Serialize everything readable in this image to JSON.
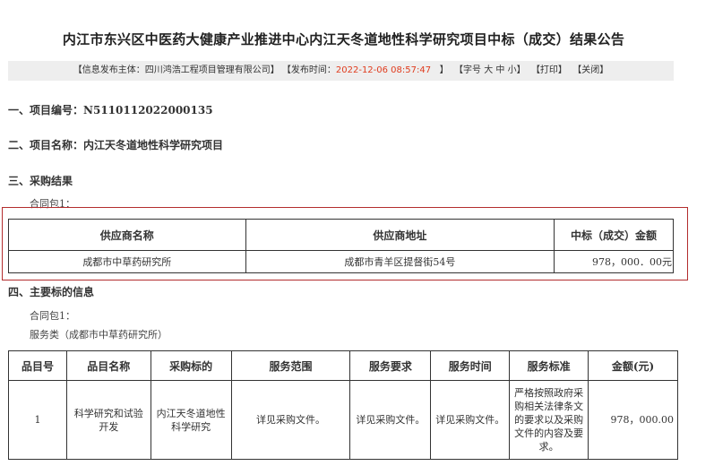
{
  "title": "内江市东兴区中医药大健康产业推进中心内江天冬道地性科学研究项目中标（成交）结果公告",
  "infobar": {
    "publisher_label": "【信息发布主体：四川鸿浩工程项目管理有限公司】",
    "time_label": "【发布时间：",
    "time_value": "2022-12-06 08:57:47",
    "time_close": "】",
    "font_size_label": "【字号",
    "font_big": "大",
    "font_mid": "中",
    "font_small": "小",
    "font_size_close": "】",
    "print": "【打印】",
    "close": "【关闭】"
  },
  "section1": {
    "label": "一、项目编号：",
    "value": "N5110112022000135"
  },
  "section2": {
    "label": "二、项目名称：内江天冬道地性科学研究项目"
  },
  "section3": {
    "label": "三、采购结果",
    "package": "合同包1："
  },
  "result_table": {
    "headers": [
      "供应商名称",
      "供应商地址",
      "中标（成交）金额"
    ],
    "row": [
      "成都市中草药研究所",
      "成都市青羊区提督街54号",
      "978，000．00元"
    ]
  },
  "section4": {
    "label": "四、主要标的信息",
    "package": "合同包1：",
    "category": "服务类（成都市中草药研究所）"
  },
  "item_table": {
    "headers": [
      "品目号",
      "品目名称",
      "采购标的",
      "服务范围",
      "服务要求",
      "服务时间",
      "服务标准",
      "金额(元)"
    ],
    "row": [
      "1",
      "科学研究和试验开发",
      "内江天冬道地性科学研究",
      "详见采购文件。",
      "详见采购文件。",
      "详见采购文件。",
      "严格按照政府采购相关法律条文的要求以及采购文件的内容及要求。",
      "978，000.00"
    ]
  }
}
